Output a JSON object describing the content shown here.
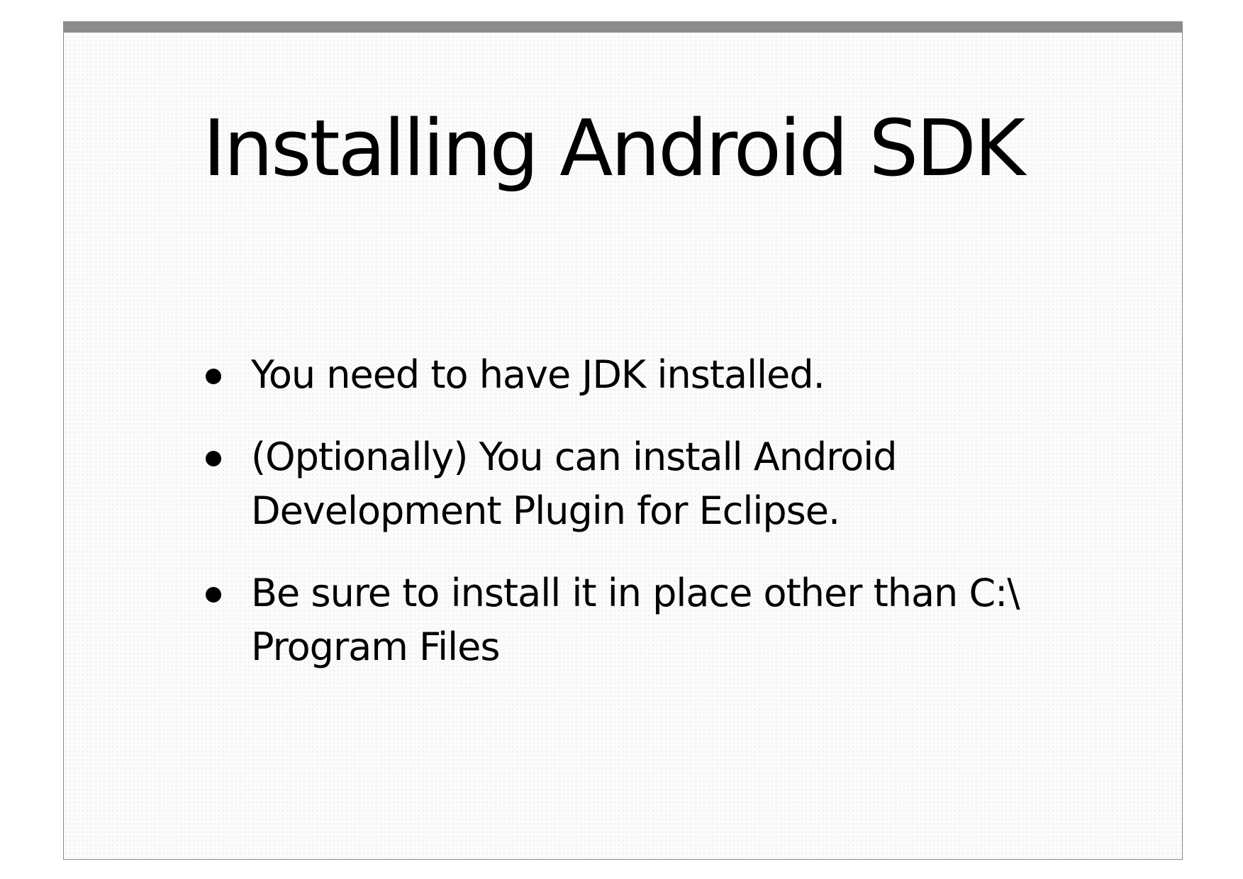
{
  "slide": {
    "title": "Installing Android SDK",
    "bullets": [
      {
        "text": "You need to have JDK installed."
      },
      {
        "text": "(Optionally) You can install Android Development Plugin for Eclipse."
      },
      {
        "text": "Be sure to install it in place other than C:\\ Program Files"
      }
    ]
  },
  "colors": {
    "background": "#ffffff",
    "slide_background": "#fbfbfb",
    "top_bar": "#8c8c8c",
    "border": "#8a8a8a",
    "text": "#000000"
  }
}
